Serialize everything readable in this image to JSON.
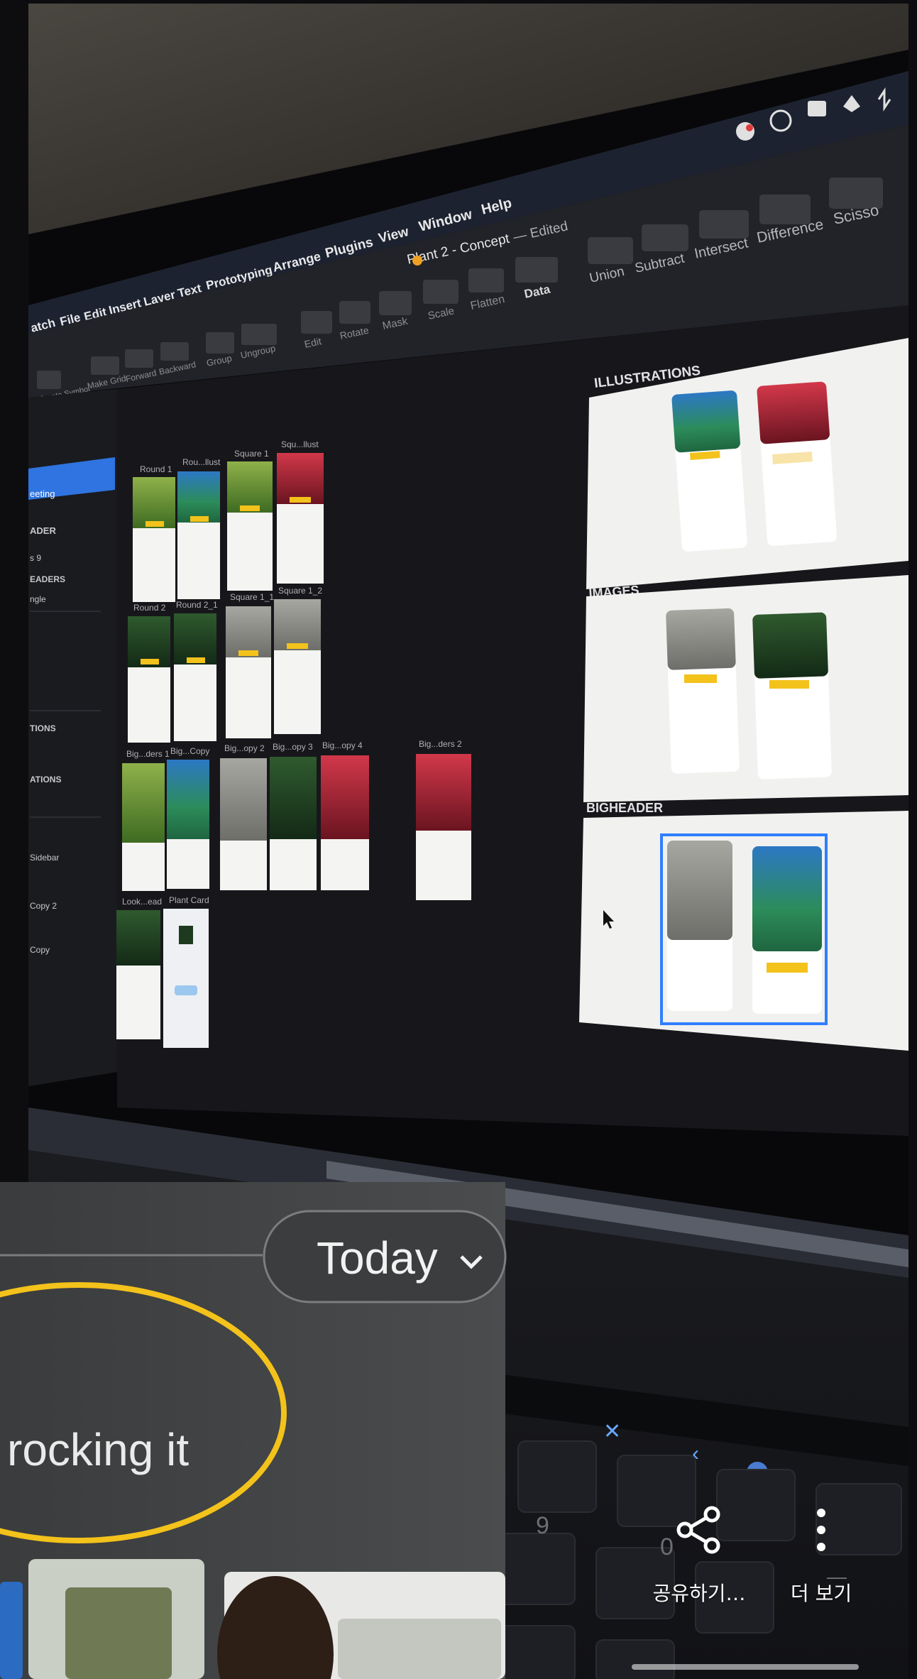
{
  "menubar": {
    "app": "atch",
    "items": [
      "File",
      "Edit",
      "Insert",
      "Layer",
      "Text",
      "Prototyping",
      "Arrange",
      "Plugins",
      "View",
      "Window",
      "Help"
    ]
  },
  "document": {
    "title": "Plant 2 - Concept",
    "status": "— Edited"
  },
  "toolbar": {
    "left_items": [
      "Create Symbol",
      "Make Grid",
      "Forward",
      "Backward",
      "Group",
      "Ungroup",
      "Edit",
      "Rotate",
      "Mask",
      "Scale",
      "Flatten",
      "Data"
    ],
    "boolean_items": [
      "Union",
      "Subtract",
      "Intersect",
      "Difference",
      "Scisso"
    ]
  },
  "artboards": {
    "row1": [
      "Round 1",
      "Rou...llust",
      "Square 1",
      "Squ...llust"
    ],
    "row2": [
      "Round 2",
      "Round 2_1",
      "Square 1_1",
      "Square 1_2"
    ],
    "row3": [
      "Big...ders 1",
      "Big...Copy",
      "Big...opy 2",
      "Big...opy 3",
      "Big...opy 4",
      "Big...ders 2"
    ],
    "row4": [
      "Look...ead",
      "Plant Card"
    ]
  },
  "sections": [
    "ILLUSTRATIONS",
    "IMAGES",
    "BIGHEADER"
  ],
  "sidebar": {
    "items": [
      "eeting",
      "ADER",
      "s 9",
      "EADERS",
      "ngle",
      "TIONS",
      "ATIONS",
      "Sidebar",
      "Copy 2",
      "Copy"
    ]
  },
  "overlay": {
    "today_label": "Today",
    "message": "rocking it"
  },
  "actions": {
    "share_label": "공유하기…",
    "more_label": "더 보기"
  },
  "colors": {
    "accent_yellow": "#f3c21b",
    "selection_blue": "#2f7fff",
    "canvas_dark": "#17171b"
  }
}
